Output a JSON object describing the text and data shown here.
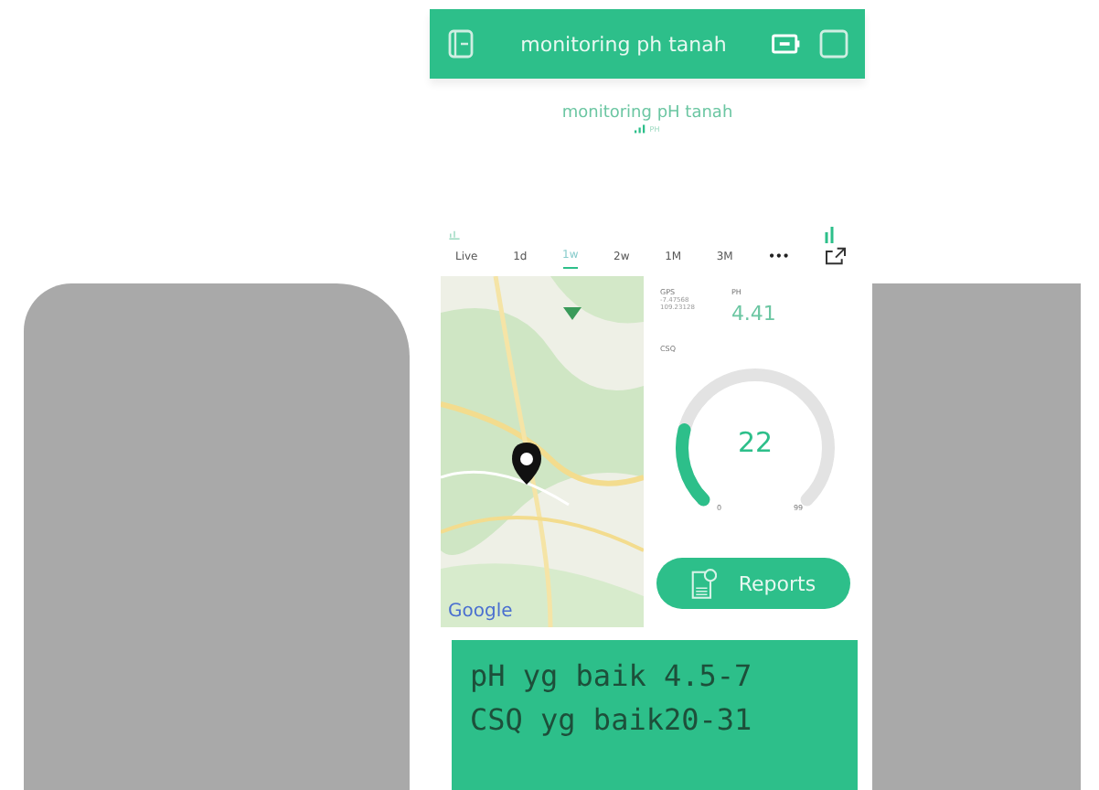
{
  "app_bar": {
    "title": "monitoring ph tanah"
  },
  "chart_widget": {
    "title": "monitoring pH tanah",
    "legend": "PH",
    "ranges": [
      {
        "label": "Live",
        "selected": false
      },
      {
        "label": "1d",
        "selected": false
      },
      {
        "label": "1w",
        "selected": true
      },
      {
        "label": "2w",
        "selected": false
      },
      {
        "label": "1M",
        "selected": false
      },
      {
        "label": "3M",
        "selected": false
      }
    ],
    "more": "•••"
  },
  "map": {
    "kind": "picture",
    "brand": "Google"
  },
  "gps": {
    "label": "GPS",
    "lines": [
      "-7.47568",
      "109.23128"
    ]
  },
  "ph": {
    "label": "PH",
    "value": "4.41"
  },
  "gauge": {
    "label": "CSQ",
    "value": "22",
    "min": "0",
    "max": "99"
  },
  "reports_button": {
    "label": "Reports"
  },
  "lcd": {
    "lines": [
      "pH yg baik 4.5-7",
      "CSQ yg baik20-31"
    ]
  }
}
